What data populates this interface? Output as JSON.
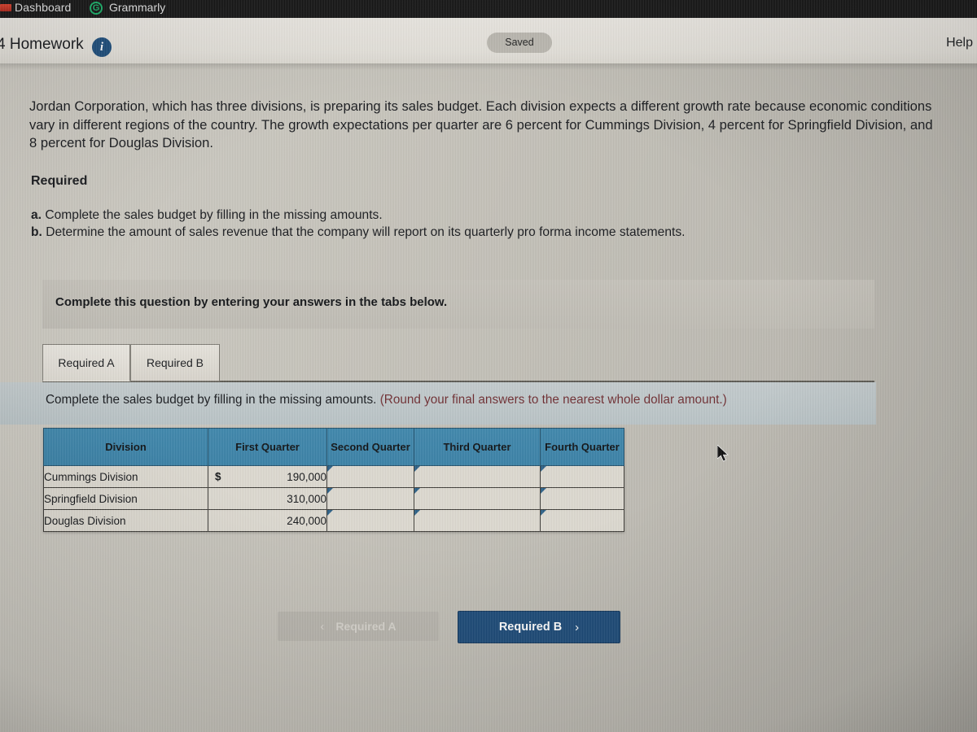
{
  "browser": {
    "bookmarks": [
      {
        "label": "Dashboard",
        "icon": "bookmark-favicon"
      },
      {
        "label": "Grammarly",
        "icon": "grammarly-icon",
        "glyph": "G"
      }
    ]
  },
  "header": {
    "assignment_title": "4 Homework",
    "info_icon_glyph": "i",
    "saved_status": "Saved",
    "help_label": "Help"
  },
  "problem": {
    "text": "Jordan Corporation, which has three divisions, is preparing its sales budget. Each division expects a different growth rate because economic conditions vary in different regions of the country. The growth expectations per quarter are 6 percent for Cummings Division, 4 percent for Springfield Division, and 8 percent for Douglas Division.",
    "required_heading": "Required",
    "requirements": [
      {
        "letter": "a.",
        "text": "Complete the sales budget by filling in the missing amounts."
      },
      {
        "letter": "b.",
        "text": "Determine the amount of sales revenue that the company will report on its quarterly pro forma income statements."
      }
    ]
  },
  "instruction_panel": {
    "text": "Complete this question by entering your answers in the tabs below."
  },
  "tabs": [
    {
      "label": "Required A",
      "active": true
    },
    {
      "label": "Required B",
      "active": false
    }
  ],
  "subinstruction": {
    "main": "Complete the sales budget by filling in the missing amounts.",
    "round_note": "(Round your final answers to the nearest whole dollar amount.)"
  },
  "table": {
    "columns": [
      "Division",
      "First Quarter",
      "Second Quarter",
      "Third Quarter",
      "Fourth Quarter"
    ],
    "rows": [
      {
        "division": "Cummings Division",
        "currency_symbol": "$",
        "first_quarter": "190,000",
        "second_quarter": "",
        "third_quarter": "",
        "fourth_quarter": ""
      },
      {
        "division": "Springfield Division",
        "currency_symbol": "",
        "first_quarter": "310,000",
        "second_quarter": "",
        "third_quarter": "",
        "fourth_quarter": ""
      },
      {
        "division": "Douglas Division",
        "currency_symbol": "",
        "first_quarter": "240,000",
        "second_quarter": "",
        "third_quarter": "",
        "fourth_quarter": ""
      }
    ]
  },
  "navigation": {
    "prev_label": "Required A",
    "prev_chevron": "‹",
    "next_label": "Required B",
    "next_chevron": "›",
    "prev_disabled": true
  },
  "colors": {
    "table_header_blue": "#3d86ab",
    "primary_button_blue": "#1b4a78",
    "disabled_button_gray": "#b9b6ae",
    "round_note_maroon": "#6e2c30",
    "info_icon_navy": "#1c4d7c"
  }
}
